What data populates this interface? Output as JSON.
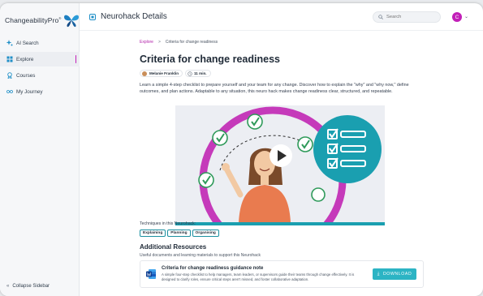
{
  "app": {
    "logo_text": "ChangeabilityPro",
    "logo_mark": "®"
  },
  "sidebar": {
    "items": [
      {
        "label": "AI Search",
        "icon": "sparkle-icon",
        "active": false
      },
      {
        "label": "Explore",
        "icon": "grid-icon",
        "active": true
      },
      {
        "label": "Courses",
        "icon": "award-icon",
        "active": false
      },
      {
        "label": "My Journey",
        "icon": "journey-icon",
        "active": false
      }
    ],
    "collapse_label": "Collapse Sidebar"
  },
  "header": {
    "title": "Neurohack Details",
    "search_placeholder": "Search",
    "avatar_initial": "C"
  },
  "breadcrumb": {
    "parent": "Explore",
    "current": "Criteria for change readiness"
  },
  "article": {
    "title": "Criteria for change readiness",
    "author": "Melanie Franklin",
    "duration": "11 min.",
    "description": "Learn a simple 4-step checklist to prepare yourself and your team for any change. Discover how to explain the \"why\" and \"why now,\" define outcomes, and plan actions. Adaptable to any situation, this neuro hack makes change readiness clear, structured, and repeatable."
  },
  "techniques": {
    "label": "Techniques in this Neurohack:",
    "tags": [
      "Explaining",
      "Planning",
      "Organising"
    ]
  },
  "resources": {
    "title": "Additional Resources",
    "subtitle": "Useful documents and learning materials to support this Neurohack",
    "item": {
      "title": "Criteria for change readiness guidance note",
      "description": "A simple four-step checklist to help managers, team leaders, or supervisors guide their teams through change effectively. It is designed to clarify roles, ensure critical steps aren't missed, and foster collaborative adaptation.",
      "download_label": "DOWNLOAD"
    }
  },
  "colors": {
    "accent": "#c21fb8",
    "teal": "#2cb4c4"
  }
}
